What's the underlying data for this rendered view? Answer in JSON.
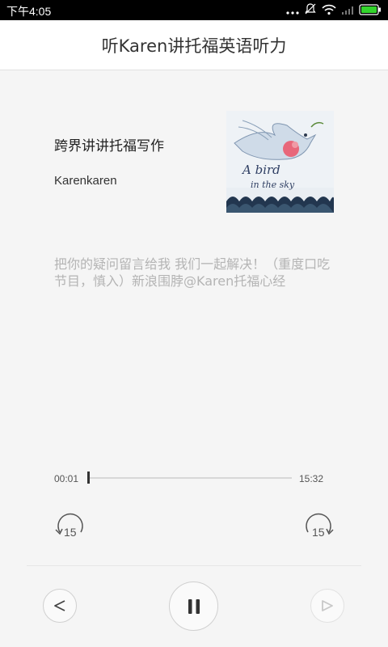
{
  "status_bar": {
    "time": "下午4:05",
    "icons": [
      "more-dots-icon",
      "notifications-off-icon",
      "wifi-icon",
      "signal-icon",
      "battery-icon"
    ]
  },
  "header": {
    "title": "听Karen讲托福英语听力"
  },
  "episode": {
    "title": "跨界讲讲托福写作",
    "author": "Karenkaren",
    "cover_art_text": [
      "A bird",
      "in the sky"
    ],
    "description": "把你的疑问留言给我 我们一起解决！（重度口吃节目，慎入）新浪围脖@Karen托福心经"
  },
  "player": {
    "current_time": "00:01",
    "total_time": "15:32",
    "progress_fraction": 0.001,
    "rewind_label": "15",
    "forward_label": "15",
    "controls": [
      "previous-icon",
      "pause-icon",
      "next-icon"
    ]
  }
}
